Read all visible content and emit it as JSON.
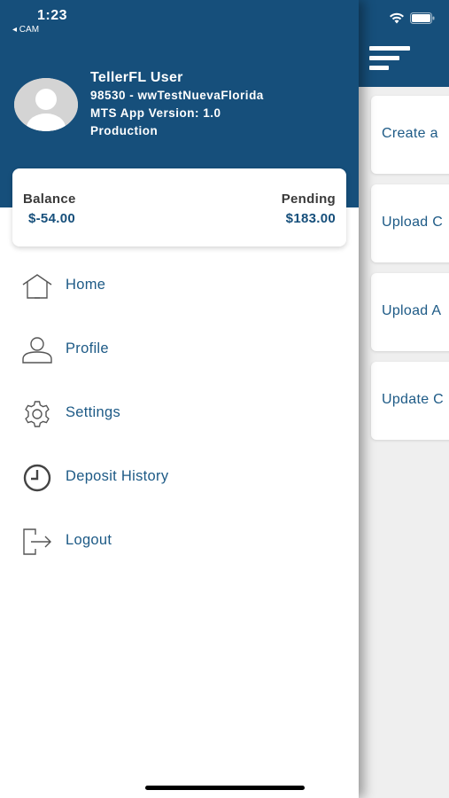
{
  "status_bar": {
    "time": "1:23",
    "back_label": "◂ CAM"
  },
  "drawer": {
    "user": {
      "name": "TellerFL User",
      "account": "98530 - wwTestNuevaFlorida",
      "version": "MTS App Version: 1.0",
      "environment": "Production"
    },
    "balance": {
      "balance_label": "Balance",
      "balance_value": "$-54.00",
      "pending_label": "Pending",
      "pending_value": "$183.00"
    },
    "menu": [
      {
        "label": "Home",
        "icon": "home-icon"
      },
      {
        "label": "Profile",
        "icon": "user-icon"
      },
      {
        "label": "Settings",
        "icon": "gear-icon"
      },
      {
        "label": "Deposit History",
        "icon": "clock-icon"
      },
      {
        "label": "Logout",
        "icon": "logout-icon"
      }
    ]
  },
  "main": {
    "actions": [
      {
        "label": "Create a"
      },
      {
        "label": "Upload C"
      },
      {
        "label": "Upload A"
      },
      {
        "label": "Update C"
      }
    ]
  },
  "colors": {
    "primary": "#164f7b",
    "link": "#1d5a86",
    "background": "#efefef"
  }
}
